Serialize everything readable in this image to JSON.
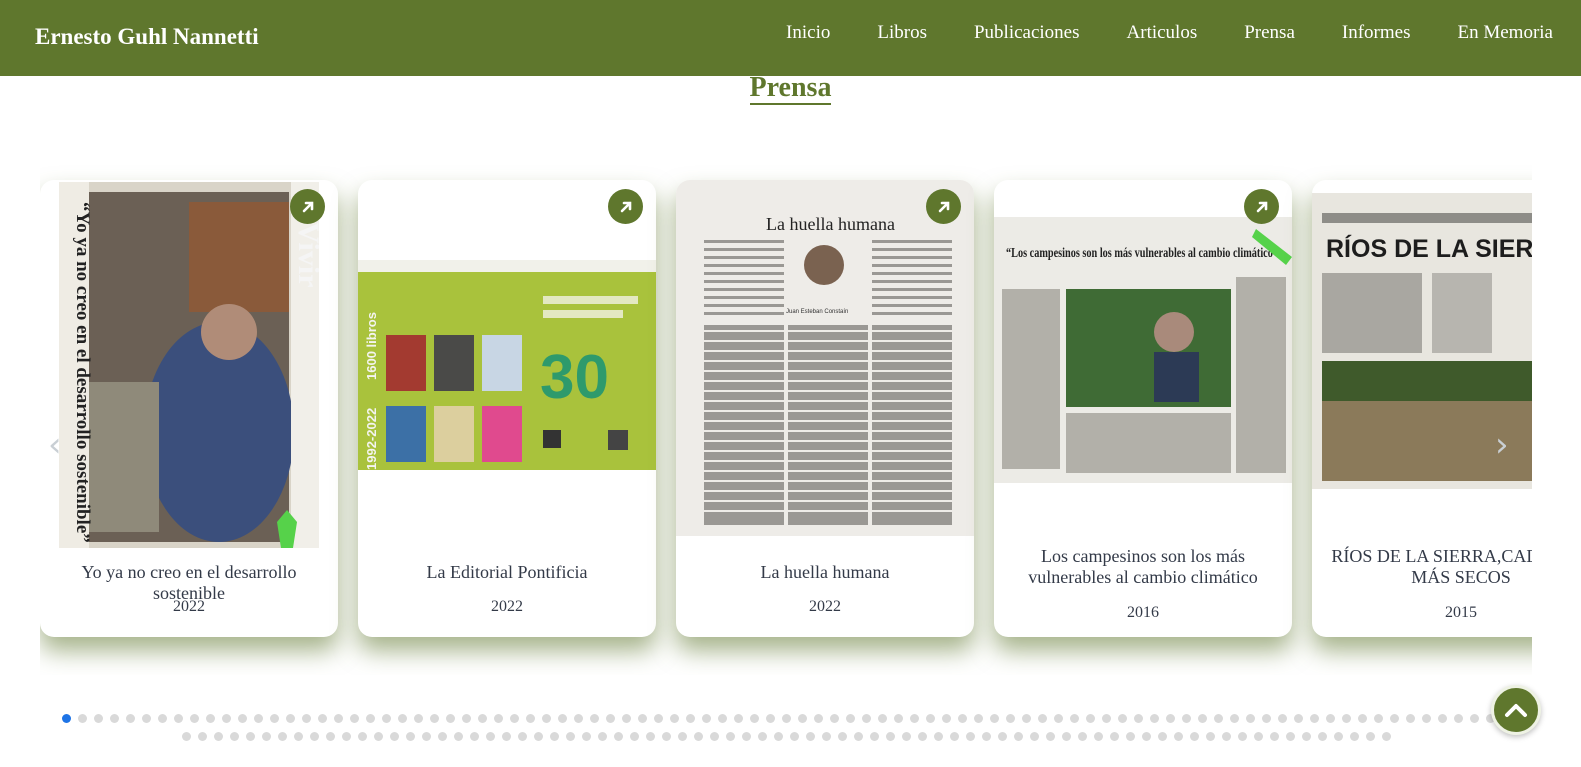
{
  "header": {
    "brand": "Ernesto Guhl Nannetti",
    "nav": [
      "Inicio",
      "Libros",
      "Publicaciones",
      "Articulos",
      "Prensa",
      "Informes",
      "En Memoria"
    ],
    "color": "#5f772d"
  },
  "section": {
    "title": "Prensa"
  },
  "cards": [
    {
      "title": "Yo ya no creo en el desarrollo sostenible",
      "year": "2022",
      "image_text": "“Yo ya no creo en el desarrollo sostenible”",
      "image_brand": "Vivir"
    },
    {
      "title": "La Editorial Pontificia",
      "year": "2022",
      "image_text": "1600 libros",
      "image_years": "1992-2022",
      "image_number": "30"
    },
    {
      "title": "La huella humana",
      "year": "2022",
      "image_text": "La huella humana",
      "image_author": "Juan Esteban Constaín"
    },
    {
      "title": "Los campesinos son los más vulnerables al cambio climático",
      "year": "2016",
      "image_text": "“Los campesinos son los más vulnerables al cambio climático”"
    },
    {
      "title": "RÍOS DE LA SIERRA,CADA VEZ MÁS SECOS",
      "year": "2015",
      "image_text": "RÍOS DE LA SIERRA, CADA VEZ"
    }
  ],
  "icons": {
    "open": "external-link-arrow-icon",
    "prev": "chevron-left-icon",
    "next": "chevron-right-icon",
    "top": "chevron-up-icon"
  },
  "pagination": {
    "active_index": 0
  }
}
